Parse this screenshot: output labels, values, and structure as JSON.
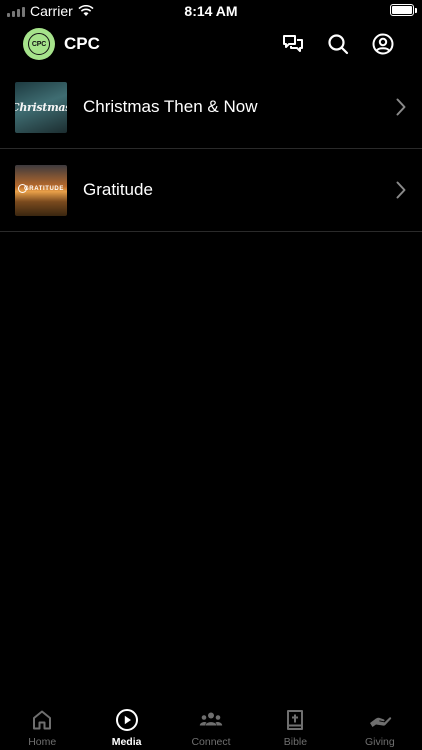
{
  "status_bar": {
    "carrier": "Carrier",
    "time": "8:14 AM"
  },
  "header": {
    "logo_text": "CPC",
    "title": "CPC",
    "icons": [
      "chat-icon",
      "search-icon",
      "account-icon"
    ]
  },
  "media_list": [
    {
      "label": "Christmas Then & Now",
      "thumb_text": "Christmas"
    },
    {
      "label": "Gratitude",
      "thumb_text": "GRATITUDE"
    }
  ],
  "tabbar": {
    "tabs": [
      {
        "label": "Home",
        "icon": "home-icon",
        "active": false
      },
      {
        "label": "Media",
        "icon": "play-icon",
        "active": true
      },
      {
        "label": "Connect",
        "icon": "people-icon",
        "active": false
      },
      {
        "label": "Bible",
        "icon": "bible-icon",
        "active": false
      },
      {
        "label": "Giving",
        "icon": "giving-icon",
        "active": false
      }
    ]
  },
  "colors": {
    "background": "#000000",
    "accent": "#a6e38b",
    "tab_inactive": "#6f6f6f",
    "tab_active": "#ffffff",
    "divider": "#2a2a2a"
  }
}
